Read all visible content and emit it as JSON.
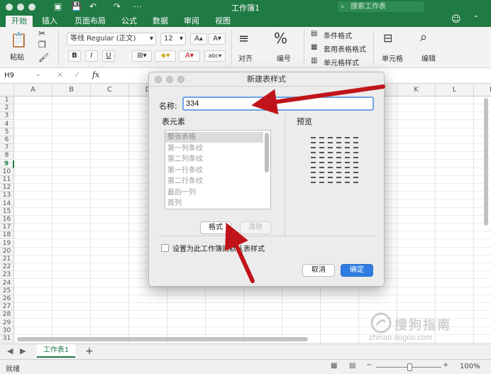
{
  "window": {
    "title": "工作簿1",
    "search_placeholder": "搜索工作表"
  },
  "ribbon_tabs": [
    "开始",
    "插入",
    "页面布局",
    "公式",
    "数据",
    "审阅",
    "视图"
  ],
  "ribbon": {
    "paste_label": "粘贴",
    "font_name": "等线 Regular (正文)",
    "font_size": "12",
    "bold": "B",
    "italic": "I",
    "underline": "U",
    "align_label": "对齐",
    "number_label": "编号",
    "number_symbol": "%",
    "conditional_format": "条件格式",
    "format_as_table": "套用表格格式",
    "cell_styles": "单元格样式",
    "cells_label": "单元格",
    "edit_label": "编辑"
  },
  "formula_bar": {
    "name_box": "H9",
    "fx": "fx"
  },
  "columns": [
    "A",
    "B",
    "C",
    "D",
    "E",
    "F",
    "G",
    "H",
    "I",
    "J",
    "K",
    "L",
    "M"
  ],
  "rows": [
    "1",
    "2",
    "3",
    "4",
    "5",
    "6",
    "7",
    "8",
    "9",
    "10",
    "11",
    "12",
    "13",
    "14",
    "15",
    "16",
    "17",
    "18",
    "19",
    "20",
    "21",
    "22",
    "23",
    "24",
    "25",
    "26",
    "27",
    "28",
    "29",
    "30",
    "31"
  ],
  "selected_row": "9",
  "sheet_tabs": {
    "active": "工作表1",
    "add": "+"
  },
  "status": {
    "ready": "就绪",
    "zoom": "100%"
  },
  "dialog": {
    "title": "新建表样式",
    "name_label": "名称:",
    "name_value": "334",
    "elements_label": "表元素",
    "preview_label": "预览",
    "elements": [
      "整张表格",
      "第一列条纹",
      "第二列条纹",
      "第一行条纹",
      "第二行条纹",
      "最后一列",
      "首列"
    ],
    "selected_element": "整张表格",
    "format_button": "格式",
    "clear_button": "清除",
    "default_checkbox_label": "设置为此工作簿的默认表样式",
    "cancel_button": "取消",
    "ok_button": "确定"
  },
  "watermark": {
    "text": "搜狗指南",
    "url": "zhinan.sogou.com"
  },
  "colors": {
    "brand_green": "#1f7a43",
    "accent_blue": "#2f7de0",
    "arrow_red": "#c0141a"
  }
}
